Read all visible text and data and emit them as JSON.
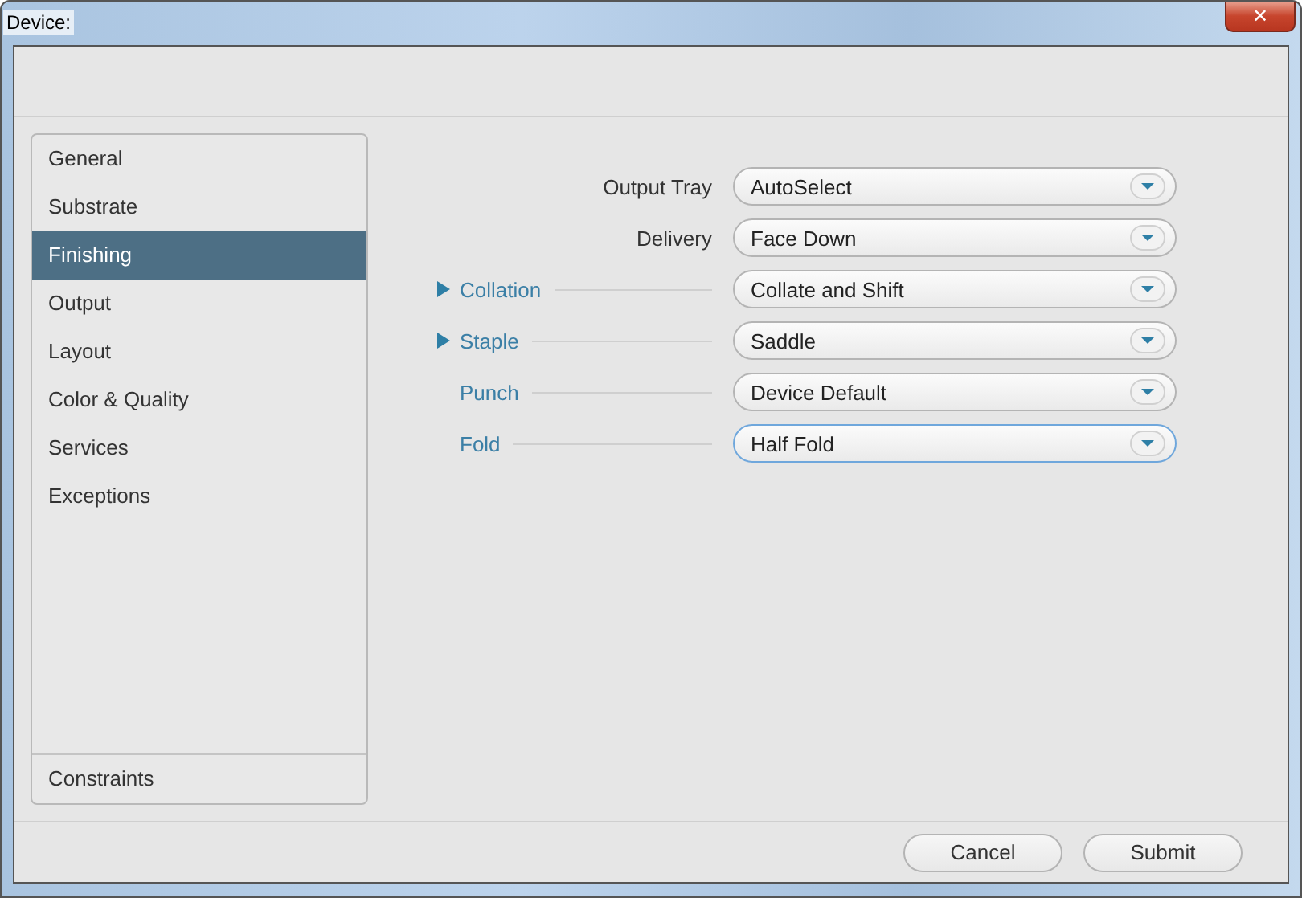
{
  "window": {
    "title": "Device:",
    "close": "✕"
  },
  "sidebar": {
    "items": [
      {
        "label": "General",
        "selected": false
      },
      {
        "label": "Substrate",
        "selected": false
      },
      {
        "label": "Finishing",
        "selected": true
      },
      {
        "label": "Output",
        "selected": false
      },
      {
        "label": "Layout",
        "selected": false
      },
      {
        "label": "Color & Quality",
        "selected": false
      },
      {
        "label": "Services",
        "selected": false
      },
      {
        "label": "Exceptions",
        "selected": false
      }
    ],
    "footer": {
      "label": "Constraints",
      "selected": false
    }
  },
  "settings": [
    {
      "kind": "plain",
      "label": "Output Tray",
      "value": "AutoSelect",
      "focused": false
    },
    {
      "kind": "plain",
      "label": "Delivery",
      "value": "Face Down",
      "focused": false
    },
    {
      "kind": "section",
      "label": "Collation",
      "expanded": false,
      "value": "Collate and Shift",
      "focused": false
    },
    {
      "kind": "section",
      "label": "Staple",
      "expanded": false,
      "value": "Saddle",
      "focused": false
    },
    {
      "kind": "section",
      "label": "Punch",
      "value": "Device Default",
      "focused": false
    },
    {
      "kind": "section",
      "label": "Fold",
      "value": "Half Fold",
      "focused": true
    }
  ],
  "buttons": [
    "Cancel",
    "Submit"
  ]
}
